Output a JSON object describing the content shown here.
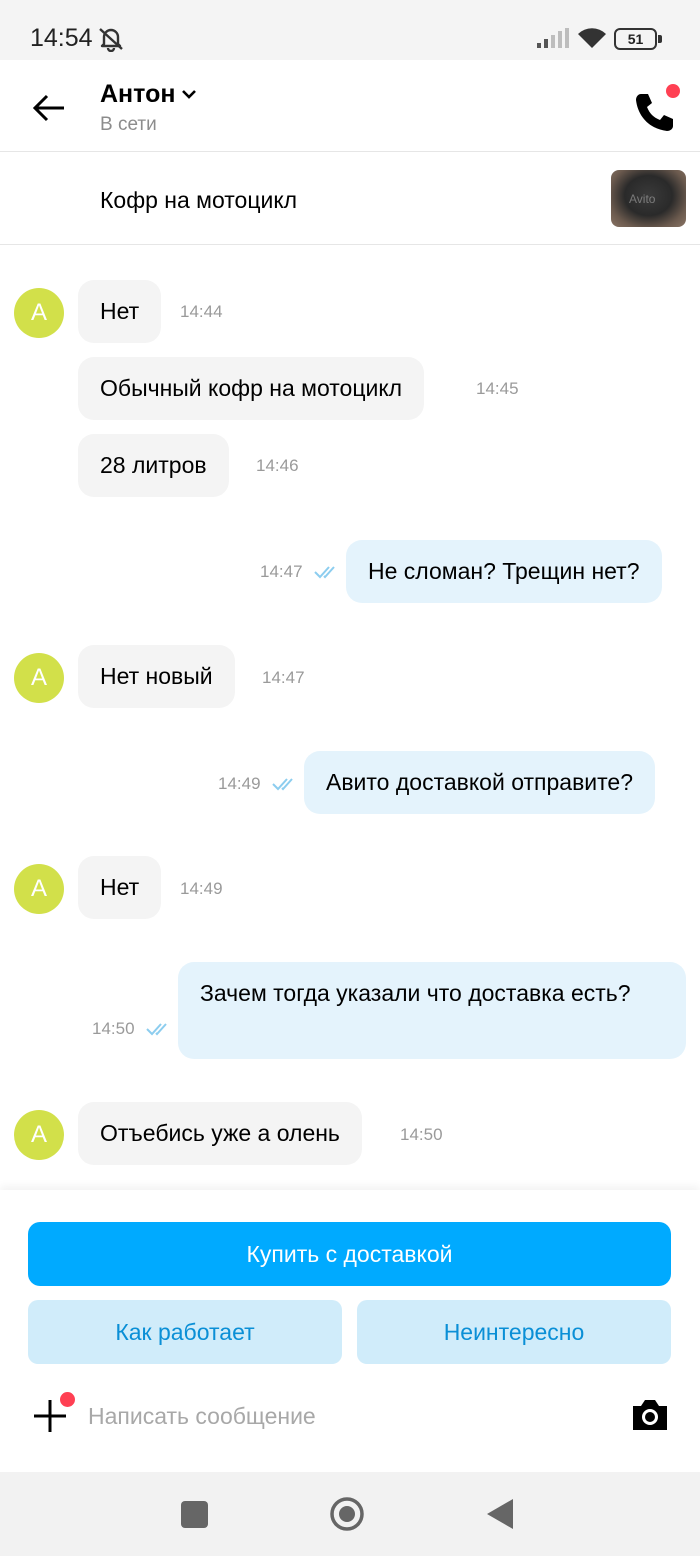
{
  "status_bar": {
    "time": "14:54",
    "battery": "51",
    "icons": [
      "bell-off-icon",
      "signal-icon",
      "wifi-icon",
      "battery-icon"
    ]
  },
  "header": {
    "contact_name": "Антон",
    "contact_status": "В сети",
    "icons": [
      "back-arrow-icon",
      "chevron-down-icon",
      "phone-icon"
    ]
  },
  "listing": {
    "title": "Кофр на мотоцикл",
    "thumb_watermark": "Avito"
  },
  "messages": [
    {
      "direction": "in",
      "avatar": "A",
      "text": "Нет",
      "time": "14:44"
    },
    {
      "direction": "in",
      "avatar": "",
      "text": "Обычный кофр на мотоцикл",
      "time": "14:45"
    },
    {
      "direction": "in",
      "avatar": "",
      "text": "28 литров",
      "time": "14:46"
    },
    {
      "direction": "out",
      "text": "Не сломан? Трещин нет?",
      "time": "14:47",
      "read": true
    },
    {
      "direction": "in",
      "avatar": "A",
      "text": "Нет новый",
      "time": "14:47"
    },
    {
      "direction": "out",
      "text": "Авито доставкой отправите?",
      "time": "14:49",
      "read": true
    },
    {
      "direction": "in",
      "avatar": "A",
      "text": "Нет",
      "time": "14:49"
    },
    {
      "direction": "out",
      "text": "Зачем тогда указали что доставка есть?",
      "time": "14:50",
      "read": true
    },
    {
      "direction": "in",
      "avatar": "A",
      "text": "Отъебись уже а олень",
      "time": "14:50"
    }
  ],
  "actions": {
    "buy_with_delivery": "Купить с доставкой",
    "how_it_works": "Как работает",
    "not_interested": "Неинтересно"
  },
  "composer": {
    "placeholder": "Написать сообщение",
    "value": "",
    "icons": [
      "plus-icon",
      "camera-icon"
    ]
  },
  "colors": {
    "accent": "#00aaff",
    "secondary_button": "#d0ecfa",
    "secondary_text": "#0a8fd6",
    "incoming_bubble": "#f4f4f4",
    "outgoing_bubble": "#e4f3fc",
    "avatar": "#d2e04a",
    "notification_dot": "#ff4053"
  },
  "nav_bar": {
    "icons": [
      "recent-apps-icon",
      "home-icon",
      "back-icon"
    ]
  }
}
